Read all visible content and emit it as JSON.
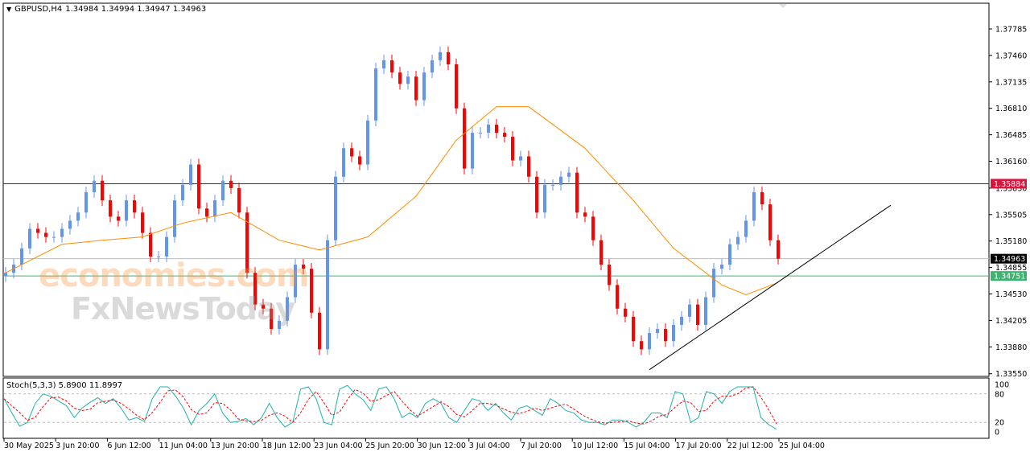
{
  "header": {
    "symbol": "GBPUSD,H4",
    "ohlc": "1.34984 1.34994 1.34947 1.34963",
    "menu_icon": "triangle-down-icon"
  },
  "watermark": {
    "line1": "economies.com",
    "line2": "FxNewsToday"
  },
  "colors": {
    "bull": "#6495ED",
    "bear": "#FF0000",
    "ma": "#FF8C00",
    "stoch_main": "#20B2AA",
    "stoch_signal": "#FF0000",
    "resistance_tag": "#DC143C",
    "support_tag": "#3CB371",
    "current_tag": "#000000"
  },
  "chart_data": {
    "type": "candlestick",
    "symbol": "GBPUSD",
    "timeframe": "H4",
    "ylim": [
      1.3355,
      1.3795
    ],
    "price_ticks": [
      "1.37785",
      "1.37460",
      "1.37135",
      "1.36810",
      "1.36485",
      "1.36160",
      "1.35830",
      "1.35505",
      "1.35180",
      "1.34855",
      "1.34530",
      "1.34205",
      "1.33880",
      "1.33550"
    ],
    "date_ticks": [
      "30 May 2025",
      "3 Jun 20:00",
      "6 Jun 12:00",
      "11 Jun 04:00",
      "13 Jun 20:00",
      "18 Jun 12:00",
      "23 Jun 04:00",
      "25 Jun 20:00",
      "30 Jun 12:00",
      "3 Jul 04:00",
      "7 Jul 20:00",
      "10 Jul 12:00",
      "15 Jul 04:00",
      "17 Jul 20:00",
      "22 Jul 12:00",
      "25 Jul 04:00"
    ],
    "first_open": 1.3475,
    "closes": [
      1.3479,
      1.3489,
      1.3509,
      1.3533,
      1.3528,
      1.3523,
      1.3523,
      1.3533,
      1.3543,
      1.3553,
      1.3578,
      1.3592,
      1.3568,
      1.3548,
      1.3543,
      1.3568,
      1.3553,
      1.3528,
      1.3499,
      1.3499,
      1.3523,
      1.3568,
      1.3587,
      1.3612,
      1.3558,
      1.3548,
      1.3568,
      1.3592,
      1.3583,
      1.3553,
      1.3479,
      1.344,
      1.3435,
      1.341,
      1.342,
      1.3449,
      1.3489,
      1.3484,
      1.343,
      1.3385,
      1.3519,
      1.3597,
      1.3632,
      1.3622,
      1.3612,
      1.3666,
      1.373,
      1.374,
      1.3725,
      1.3711,
      1.372,
      1.3691,
      1.3725,
      1.374,
      1.375,
      1.3735,
      1.3681,
      1.3607,
      1.3651,
      1.3651,
      1.3661,
      1.3651,
      1.3646,
      1.3617,
      1.3622,
      1.3597,
      1.3553,
      1.3587,
      1.3587,
      1.3597,
      1.3602,
      1.3553,
      1.3548,
      1.3519,
      1.3489,
      1.3464,
      1.3435,
      1.3425,
      1.3395,
      1.3385,
      1.3405,
      1.341,
      1.3395,
      1.3415,
      1.3425,
      1.344,
      1.3415,
      1.3449,
      1.3484,
      1.3489,
      1.3514,
      1.3523,
      1.3543,
      1.3578,
      1.3563,
      1.3519,
      1.34963
    ],
    "moving_average": [
      [
        0,
        1.3479
      ],
      [
        7,
        1.3514
      ],
      [
        12,
        1.3519
      ],
      [
        17,
        1.3523
      ],
      [
        22,
        1.354
      ],
      [
        28,
        1.3553
      ],
      [
        34,
        1.3519
      ],
      [
        39,
        1.3507
      ],
      [
        45,
        1.3523
      ],
      [
        51,
        1.3573
      ],
      [
        56,
        1.3642
      ],
      [
        61,
        1.3683
      ],
      [
        65,
        1.3683
      ],
      [
        72,
        1.3632
      ],
      [
        78,
        1.3568
      ],
      [
        83,
        1.3509
      ],
      [
        89,
        1.3464
      ],
      [
        92,
        1.3452
      ],
      [
        96,
        1.3467
      ]
    ],
    "horizontal_lines": [
      {
        "price": 1.35884,
        "label": "1.35884",
        "role": "resistance"
      },
      {
        "price": 1.34963,
        "label": "1.34963",
        "role": "current"
      },
      {
        "price": 1.34751,
        "label": "1.34751",
        "role": "support"
      }
    ],
    "trendline": {
      "from": [
        80,
        1.336
      ],
      "to": [
        110,
        1.3562
      ]
    },
    "stochastic": {
      "label": "Stoch(5,3,3) 5.8900 11.8997",
      "params": [
        5,
        3,
        3
      ],
      "main": 5.89,
      "signal": 11.8997,
      "levels": [
        20,
        80
      ],
      "scale_labels": [
        "100",
        "80",
        "20",
        "0"
      ],
      "k": [
        70,
        40,
        12,
        20,
        60,
        80,
        75,
        65,
        55,
        30,
        50,
        62,
        72,
        60,
        70,
        50,
        25,
        30,
        22,
        70,
        95,
        95,
        75,
        50,
        15,
        45,
        60,
        80,
        40,
        20,
        22,
        28,
        15,
        30,
        60,
        30,
        10,
        20,
        90,
        95,
        70,
        20,
        15,
        90,
        98,
        80,
        68,
        45,
        90,
        95,
        70,
        30,
        40,
        30,
        60,
        70,
        60,
        30,
        20,
        45,
        70,
        65,
        45,
        60,
        40,
        25,
        50,
        55,
        45,
        35,
        70,
        60,
        45,
        40,
        25,
        20,
        20,
        15,
        25,
        25,
        20,
        10,
        20,
        40,
        40,
        30,
        85,
        80,
        20,
        30,
        85,
        80,
        60,
        85,
        95,
        95,
        95,
        30,
        15,
        5.89
      ]
    }
  }
}
